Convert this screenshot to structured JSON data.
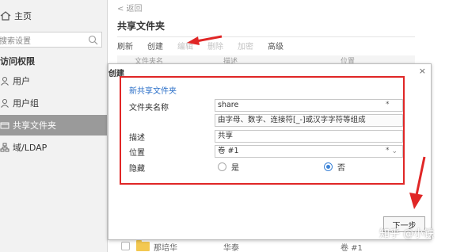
{
  "sidebar": {
    "home": "主页",
    "search_placeholder": "搜索设置",
    "section": "访问权限",
    "items": [
      {
        "label": "用户",
        "icon": "user-icon"
      },
      {
        "label": "用户组",
        "icon": "user-group-icon"
      },
      {
        "label": "共享文件夹",
        "icon": "shared-folder-icon",
        "active": true
      },
      {
        "label": "域/LDAP",
        "icon": "domain-icon"
      }
    ]
  },
  "main": {
    "back": "< 返回",
    "title": "共享文件夹",
    "toolbar": [
      "刷新",
      "创建",
      "编辑",
      "删除",
      "加密",
      "高级"
    ],
    "columns": [
      "文件夹名",
      "描述",
      "位置"
    ],
    "row": {
      "name": "那培华",
      "desc": "华泰",
      "location": "卷 #1"
    }
  },
  "dialog": {
    "title": "创建",
    "section": "新共享文件夹",
    "labels": {
      "name": "文件夹名称",
      "desc": "描述",
      "location": "位置",
      "hidden": "隐藏"
    },
    "name_value": "share",
    "name_hint": "由字母、数字、连接符[_-]或汉字字符等组成",
    "desc_value": "共享",
    "location_value": "卷 #1",
    "hidden_options": [
      "是",
      "否"
    ],
    "hidden_selected": "否",
    "required_mark": "*",
    "close": "×",
    "next": "下一步"
  },
  "watermark": "知乎 @小铁",
  "colors": {
    "annotation": "#e02626",
    "accent": "#2b6fc8",
    "radio": "#3b82d6",
    "active_bg": "#9a9a9a"
  }
}
